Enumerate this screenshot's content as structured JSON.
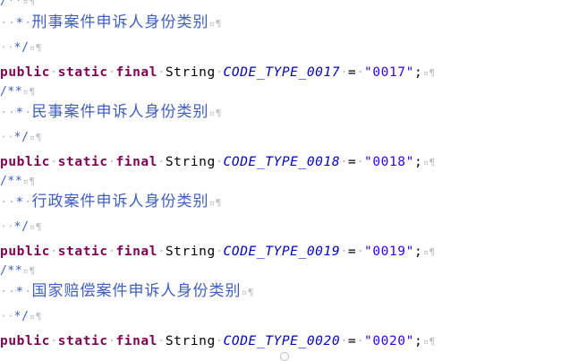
{
  "editor": {
    "marks": {
      "space": "·",
      "cr": "¤",
      "pilcrow": "¶"
    },
    "blocks": [
      {
        "open": "/**",
        "desc": "刑事案件申诉人身份类别",
        "close": "*/",
        "kw_public": "public",
        "kw_static": "static",
        "kw_final": "final",
        "type": "String",
        "name": "CODE_TYPE_0017",
        "eq": "=",
        "value": "\"0017\"",
        "semi": ";"
      },
      {
        "open": "/**",
        "desc": "民事案件申诉人身份类别",
        "close": "*/",
        "kw_public": "public",
        "kw_static": "static",
        "kw_final": "final",
        "type": "String",
        "name": "CODE_TYPE_0018",
        "eq": "=",
        "value": "\"0018\"",
        "semi": ";"
      },
      {
        "open": "/**",
        "desc": "行政案件申诉人身份类别",
        "close": "*/",
        "kw_public": "public",
        "kw_static": "static",
        "kw_final": "final",
        "type": "String",
        "name": "CODE_TYPE_0019",
        "eq": "=",
        "value": "\"0019\"",
        "semi": ";"
      },
      {
        "open": "/**",
        "desc": "国家赔偿案件申诉人身份类别",
        "close": "*/",
        "kw_public": "public",
        "kw_static": "static",
        "kw_final": "final",
        "type": "String",
        "name": "CODE_TYPE_0020",
        "eq": "=",
        "value": "\"0020\"",
        "semi": ";"
      }
    ]
  }
}
